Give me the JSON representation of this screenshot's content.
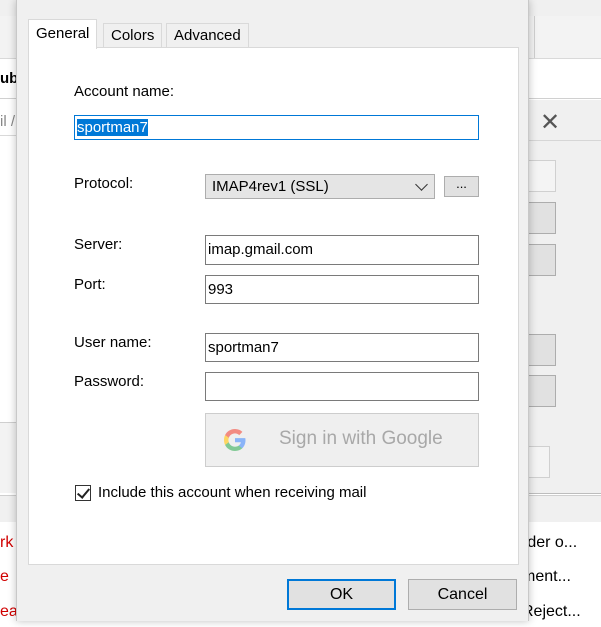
{
  "background": {
    "partial_texts": {
      "ub": "ub",
      "l_slash": "il /",
      "row1_left": "rk",
      "row2_left": "e",
      "row3_left": "eal",
      "row1_right": "rder o...",
      "row2_right": "ment...",
      "row3_right": "Reject..."
    },
    "close_glyph": "✕"
  },
  "dialog": {
    "tabs": [
      {
        "label": "General",
        "active": true
      },
      {
        "label": "Colors",
        "active": false
      },
      {
        "label": "Advanced",
        "active": false
      }
    ],
    "account_name": {
      "label": "Account name:",
      "value": "sportman7"
    },
    "protocol": {
      "label": "Protocol:",
      "value": "IMAP4rev1 (SSL)",
      "browse_label": "..."
    },
    "server": {
      "label": "Server:",
      "value": "imap.gmail.com"
    },
    "port": {
      "label": "Port:",
      "value": "993"
    },
    "user_name": {
      "label": "User name:",
      "value": "sportman7"
    },
    "password": {
      "label": "Password:",
      "value": ""
    },
    "google_button": {
      "label": "Sign in with Google",
      "enabled": false
    },
    "include_checkbox": {
      "label": "Include this account when receiving mail",
      "checked": true
    },
    "ok_label": "OK",
    "cancel_label": "Cancel"
  },
  "colors": {
    "accent": "#0078d7",
    "warning_text": "#d00000"
  }
}
